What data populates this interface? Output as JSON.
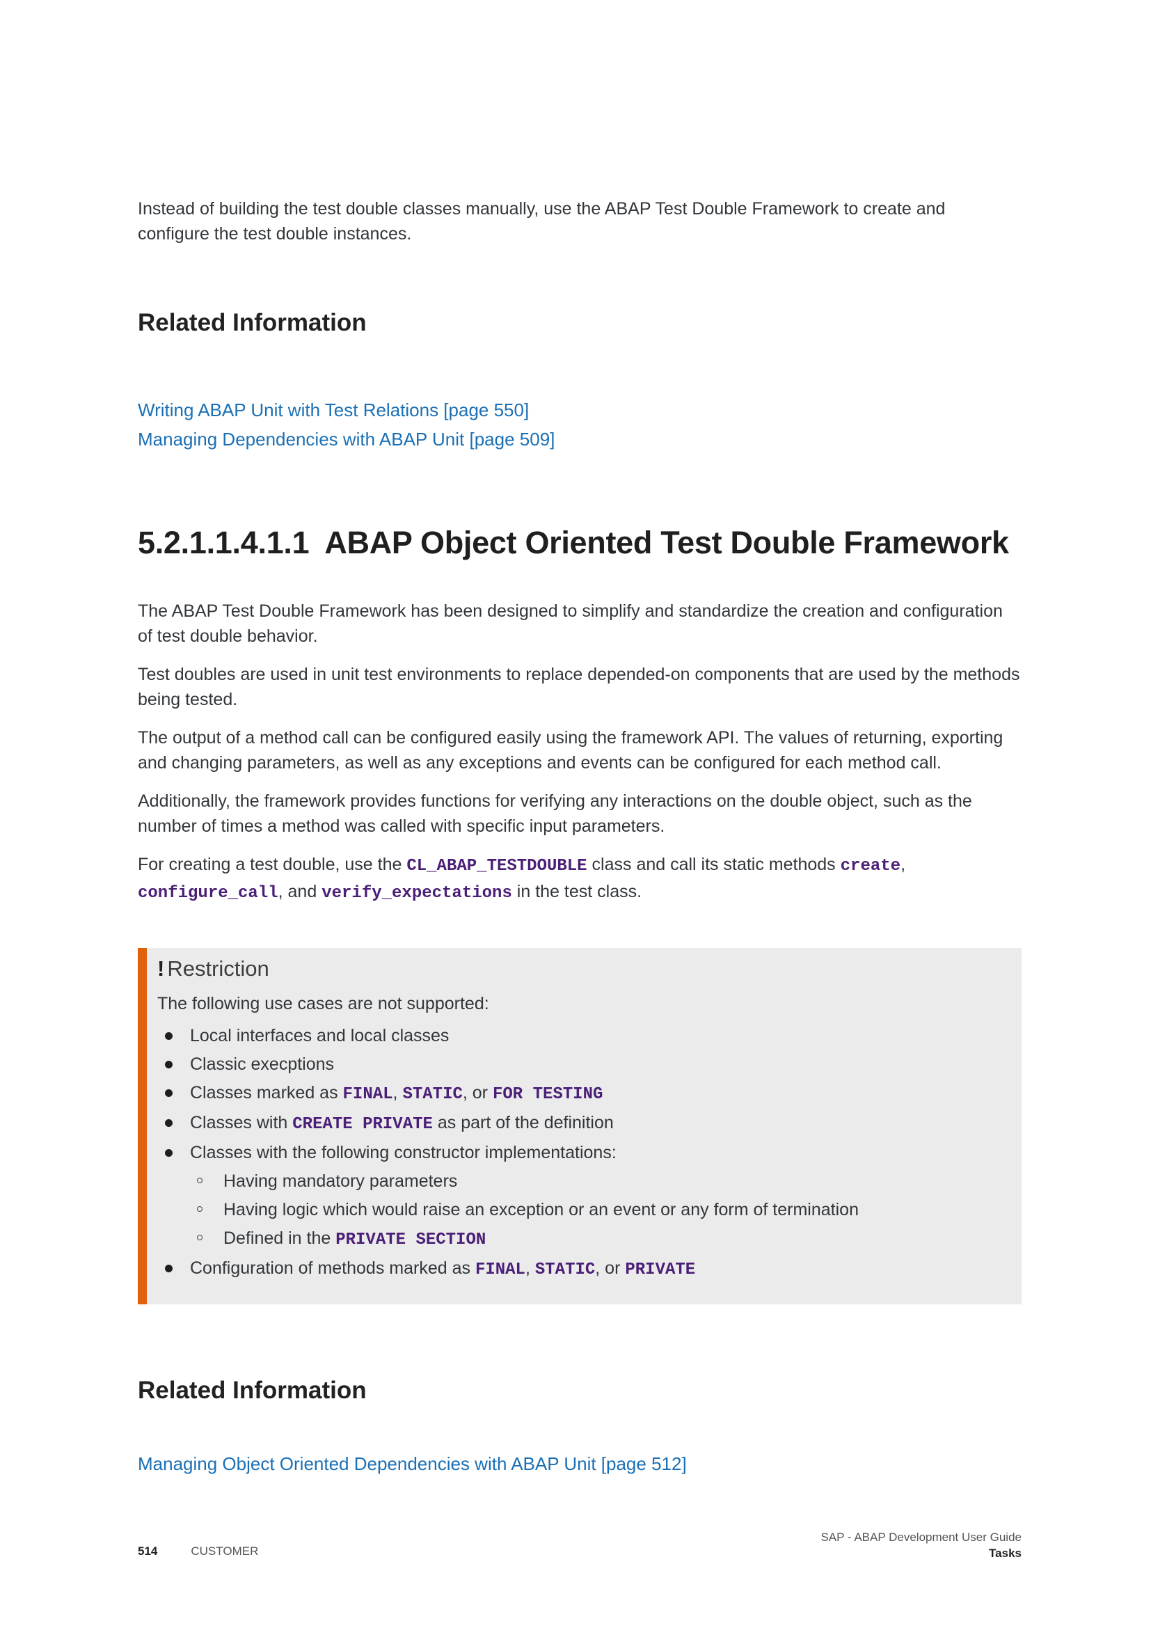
{
  "intro": {
    "text": "Instead of building the test double classes manually, use the ABAP Test Double Framework to create and configure the test double instances."
  },
  "related_1": {
    "heading": "Related Information",
    "links": [
      "Writing ABAP Unit with Test Relations [page 550]",
      "Managing Dependencies with ABAP Unit [page 509]"
    ]
  },
  "section": {
    "number": "5.2.1.1.4.1.1",
    "title": "ABAP Object Oriented Test Double Framework",
    "paragraphs": [
      "The ABAP Test Double Framework has been designed to simplify and standardize the creation and configuration of test double behavior.",
      "Test doubles are used in unit test environments to replace depended-on components that are used by the methods being tested.",
      "The output of a method call can be configured easily using the framework API. The values of returning, exporting and changing parameters, as well as any exceptions and events can be configured for each method call.",
      "Additionally, the framework provides functions for verifying any interactions on the double object, such as the number of times a method was called with specific input parameters."
    ],
    "creating": {
      "t1": "For creating a test double, use the ",
      "c1": "CL_ABAP_TESTDOUBLE",
      "t2": " class and call its static methods ",
      "c2": "create",
      "t3": ", ",
      "c3": "configure_call",
      "t4": ", and ",
      "c4": "verify_expectations",
      "t5": " in the test class."
    }
  },
  "restriction": {
    "icon": "!",
    "title": "Restriction",
    "intro": "The following use cases are not supported:",
    "item1": "Local interfaces and local classes",
    "item2": "Classic execptions",
    "item3": {
      "t1": "Classes marked as ",
      "c1": "FINAL",
      "t2": ", ",
      "c2": "STATIC",
      "t3": ", or ",
      "c3": "FOR TESTING"
    },
    "item4": {
      "t1": "Classes with ",
      "c1": "CREATE PRIVATE",
      "t2": " as part of the definition"
    },
    "item5": "Classes with the following constructor implementations:",
    "sub1": "Having mandatory parameters",
    "sub2": "Having logic which would raise an exception or an event or any form of termination",
    "sub3": {
      "t1": "Defined in the ",
      "c1": "PRIVATE SECTION"
    },
    "item6": {
      "t1": "Configuration of methods marked as ",
      "c1": "FINAL",
      "t2": ", ",
      "c2": "STATIC",
      "t3": ", or ",
      "c3": "PRIVATE"
    }
  },
  "related_2": {
    "heading": "Related Information",
    "links": [
      "Managing Object Oriented Dependencies with ABAP Unit [page 512]"
    ]
  },
  "footer": {
    "page_number": "514",
    "classification": "CUSTOMER",
    "doc_title": "SAP - ABAP Development User Guide",
    "chapter": "Tasks"
  },
  "colors": {
    "link": "#1b70b5",
    "code": "#4b1f78",
    "restriction_bar": "#e0620d",
    "restriction_bg": "#ebebeb"
  }
}
